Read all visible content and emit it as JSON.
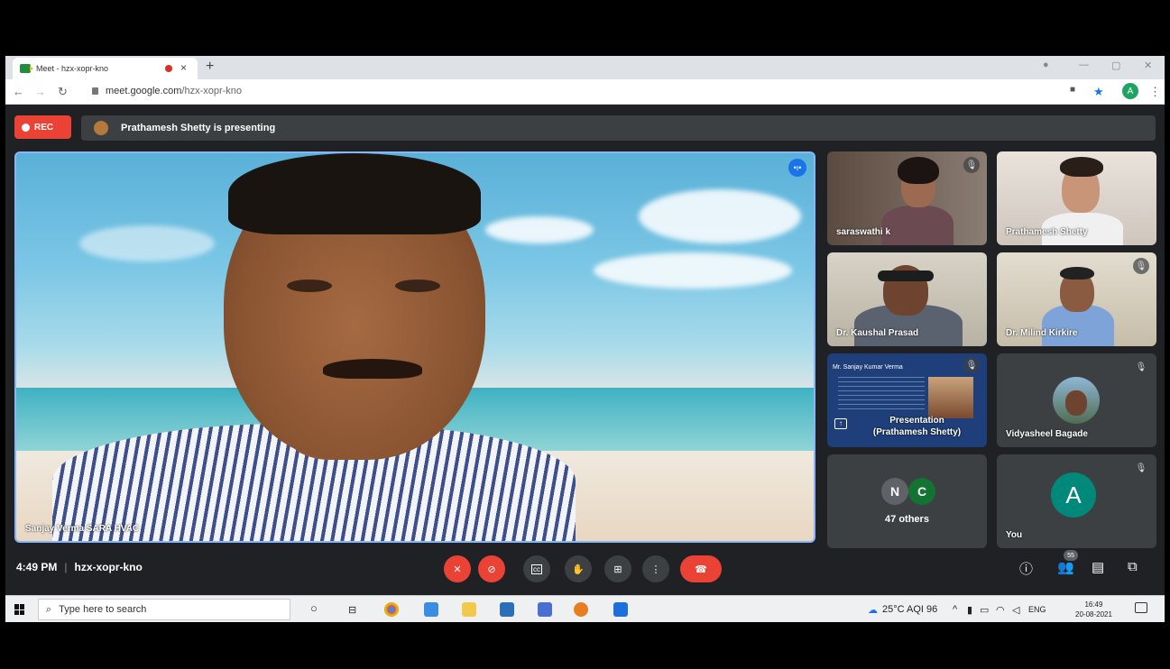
{
  "browser": {
    "tab_title": "Meet - hzx-xopr-kno",
    "tab_close": "×",
    "new_tab": "+",
    "url_host": "meet.google.com",
    "url_path": "/hzx-xopr-kno",
    "profile_initial": "A",
    "window_controls": [
      "—",
      "▢",
      "✕"
    ]
  },
  "meet": {
    "rec_label": "REC",
    "presenting_text": "Prathamesh Shetty is presenting",
    "main_speaker_name": "Sanjay Verma SARA HVAC",
    "participants": [
      {
        "name": "saraswathi k",
        "muted": true
      },
      {
        "name": "Prathamesh Shetty",
        "muted": false
      },
      {
        "name": "Dr. Kaushal Prasad",
        "muted": false
      },
      {
        "name": "Dr. Milind Kirkire",
        "muted": true
      },
      {
        "name": "Presentation\n(Prathamesh Shetty)",
        "slide_title": "Mr. Sanjay Kumar Verma"
      },
      {
        "name": "Vidyasheel Bagade",
        "muted": true
      },
      {
        "name": "47 others",
        "initials": [
          "N",
          "C"
        ]
      },
      {
        "name": "You",
        "initial": "A",
        "muted": true
      }
    ],
    "time": "4:49 PM",
    "meeting_code": "hzx-xopr-kno",
    "participant_count": "55"
  },
  "taskbar": {
    "search_placeholder": "Type here to search",
    "weather": "25°C AQI 96",
    "language": "ENG",
    "clock_time": "16:49",
    "clock_date": "20-08-2021"
  },
  "colors": {
    "meet_bg": "#202124",
    "tile_bg": "#3c4043",
    "red": "#ea4335",
    "active_border": "#8ab4f8"
  }
}
